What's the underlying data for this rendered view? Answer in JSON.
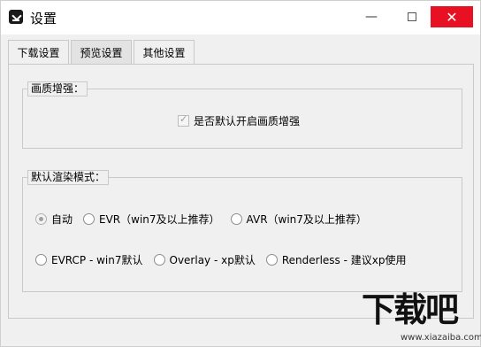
{
  "window": {
    "title": "设置"
  },
  "tabs": [
    {
      "label": "下载设置",
      "active": false
    },
    {
      "label": "预览设置",
      "active": true
    },
    {
      "label": "其他设置",
      "active": false
    }
  ],
  "quality_group": {
    "title": "画质增强：",
    "checkbox": {
      "label": "是否默认开启画质增强",
      "checked": true,
      "disabled": true
    }
  },
  "render_group": {
    "title": "默认渲染模式：",
    "options_row1": [
      {
        "label": "自动",
        "checked": true
      },
      {
        "label": "EVR（win7及以上推荐）",
        "checked": false
      },
      {
        "label": "AVR（win7及以上推荐）",
        "checked": false
      }
    ],
    "options_row2": [
      {
        "label": "EVRCP - win7默认",
        "checked": false
      },
      {
        "label": "Overlay - xp默认",
        "checked": false
      },
      {
        "label": "Renderless - 建议xp使用",
        "checked": false
      }
    ]
  },
  "watermark": {
    "main": "下载吧",
    "sub": "www.xiazaiba.com"
  },
  "colors": {
    "close_button": "#e81123",
    "background": "#f0f0f0"
  },
  "icons": {
    "app": "download-app-icon",
    "minimize": "minimize-icon",
    "maximize": "maximize-icon",
    "close": "close-icon"
  }
}
